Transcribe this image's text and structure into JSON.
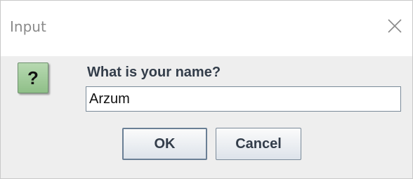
{
  "dialog": {
    "title": "Input",
    "icon": "question-mark-icon",
    "icon_glyph": "?",
    "prompt": "What is your name?",
    "input_value": "Arzum",
    "ok_label": "OK",
    "cancel_label": "Cancel",
    "close_icon": "close-icon"
  },
  "colors": {
    "content_background": "#eeeeee",
    "icon_green": "#9fcb98",
    "label_text": "#333d4a"
  }
}
